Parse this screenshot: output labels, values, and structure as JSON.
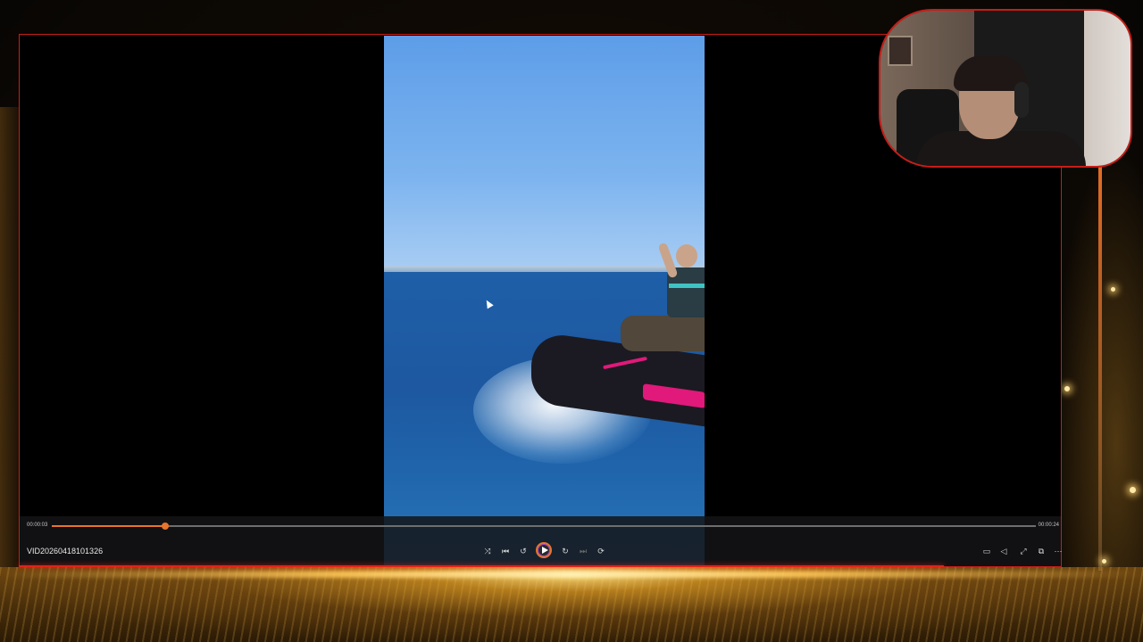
{
  "player": {
    "file_name": "VID20260418101326",
    "time_current": "00:00:03",
    "time_total": "00:00:24",
    "progress_fraction": 0.115,
    "accent_color": "#e8752a"
  },
  "controls": {
    "left_icons": [
      "shuffle-icon",
      "previous-icon",
      "rewind-10-icon",
      "play-icon",
      "forward-30-icon",
      "next-icon",
      "repeat-icon"
    ],
    "right_icons": [
      "miniplayer-icon",
      "volume-icon",
      "fullscreen-icon",
      "cast-icon",
      "more-icon"
    ]
  },
  "colors": {
    "frame_red": "#c81d18",
    "background_gold": "#e6b04a"
  }
}
